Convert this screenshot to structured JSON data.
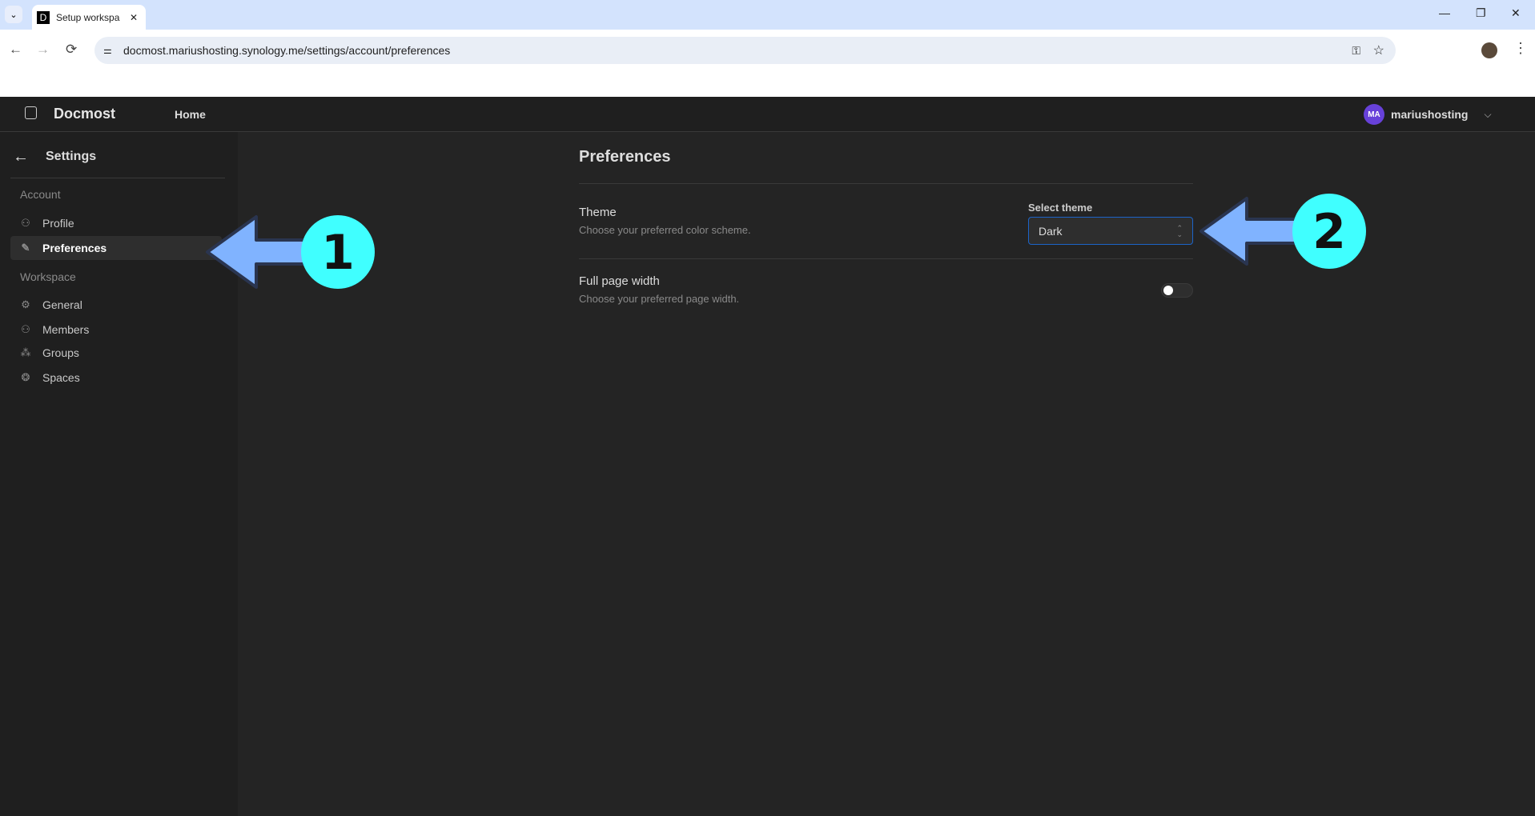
{
  "browser": {
    "tab_title": "Setup workspa",
    "favicon": "D",
    "url": "docmost.mariushosting.synology.me/settings/account/preferences"
  },
  "header": {
    "app_name": "Docmost",
    "home": "Home",
    "avatar_initials": "MA",
    "username": "mariushosting",
    "avatar_color": "#6741d9"
  },
  "sidebar": {
    "title": "Settings",
    "sections": [
      {
        "label": "Account",
        "items": [
          {
            "label": "Profile",
            "icon": "user-icon"
          },
          {
            "label": "Preferences",
            "icon": "brush-icon",
            "active": true
          }
        ]
      },
      {
        "label": "Workspace",
        "items": [
          {
            "label": "General",
            "icon": "gear-icon"
          },
          {
            "label": "Members",
            "icon": "users-icon"
          },
          {
            "label": "Groups",
            "icon": "groups-icon"
          },
          {
            "label": "Spaces",
            "icon": "spaces-icon"
          }
        ]
      }
    ]
  },
  "main": {
    "title": "Preferences",
    "theme": {
      "label": "Theme",
      "description": "Choose your preferred color scheme.",
      "select_label": "Select theme",
      "value": "Dark"
    },
    "width": {
      "label": "Full page width",
      "description": "Choose your preferred page width.",
      "enabled": false
    }
  },
  "annotations": {
    "step1": "1",
    "step2": "2",
    "arrow_color": "#80b3ff",
    "badge_color": "#40ffff"
  }
}
